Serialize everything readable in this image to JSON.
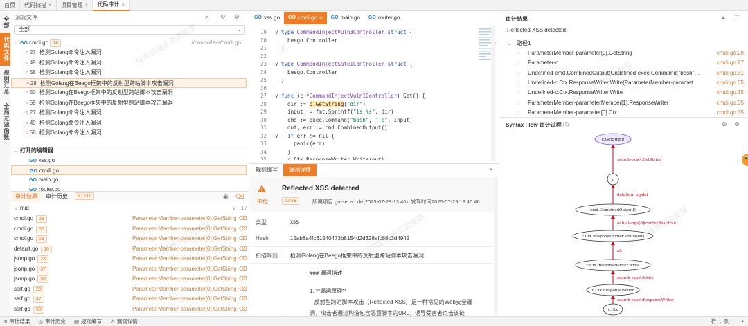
{
  "top_tabs": [
    {
      "label": "首页",
      "active": false,
      "closable": false
    },
    {
      "label": "代码扫描",
      "active": false,
      "closable": true
    },
    {
      "label": "项目管理",
      "active": false,
      "closable": true
    },
    {
      "label": "代码审计",
      "active": true,
      "closable": true
    }
  ],
  "vertical_tabs": [
    "全部",
    "代码文件",
    "规则汇总",
    "全局过滤函数"
  ],
  "file_panel": {
    "title": "漏洞文件",
    "filter_value": "全部",
    "file_name": "cmdi.go",
    "file_count": "18",
    "file_path": "//controllers/cmdi.go",
    "items": [
      {
        "line": "27",
        "text": "检测Golang命令注入漏洞",
        "selected": false
      },
      {
        "line": "49",
        "text": "检测Golang命令注入漏洞",
        "selected": false
      },
      {
        "line": "58",
        "text": "检测Golang命令注入漏洞",
        "selected": false
      },
      {
        "line": "28",
        "text": "检测Golang在Beego框架中的反射型跨站脚本攻击漏洞",
        "selected": true
      },
      {
        "line": "50",
        "text": "检测Golang在Beego框架中的反射型跨站脚本攻击漏洞",
        "selected": false
      },
      {
        "line": "59",
        "text": "检测Golang在Beego框架中的反射型跨站脚本攻击漏洞",
        "selected": false
      },
      {
        "line": "27",
        "text": "检测Golang命令注入漏洞",
        "selected": false
      },
      {
        "line": "49",
        "text": "检测Golang命令注入漏洞",
        "selected": false
      },
      {
        "line": "58",
        "text": "检测Golang命令注入漏洞",
        "selected": false
      }
    ],
    "open_editors_title": "打开的编辑器",
    "open_editors": [
      {
        "name": "xss.go",
        "selected": false
      },
      {
        "name": "cmdi.go",
        "selected": true
      },
      {
        "name": "main.go",
        "selected": false
      },
      {
        "name": "router.go",
        "selected": false
      }
    ]
  },
  "results_panel": {
    "tabs": [
      "审计结果",
      "审计历史"
    ],
    "id_badge": "ID:111",
    "group_name": "mid",
    "group_count": "17",
    "rows": [
      {
        "file": "cmdi.go",
        "count": "28",
        "func": "ParameterMember-parameter[0].GetString"
      },
      {
        "file": "cmdi.go",
        "count": "50",
        "func": "ParameterMember-parameter[0].GetString"
      },
      {
        "file": "cmdi.go",
        "count": "59",
        "func": "ParameterMember-parameter[0].GetString"
      },
      {
        "file": "default.go",
        "count": "16",
        "func": "ParameterMember-parameter[0].GetString"
      },
      {
        "file": "jsonp.go",
        "count": "23",
        "func": "ParameterMember-parameter[0].GetString"
      },
      {
        "file": "jsonp.go",
        "count": "37",
        "func": "ParameterMember-parameter[0].GetString"
      },
      {
        "file": "jsonp.go",
        "count": "58",
        "func": "ParameterMember-parameter[0].GetString"
      },
      {
        "file": "ssrf.go",
        "count": "28",
        "func": "ParameterMember-parameter[0].GetString"
      },
      {
        "file": "ssrf.go",
        "count": "47",
        "func": "ParameterMember-parameter[0].GetString"
      },
      {
        "file": "ssrf.go",
        "count": "68",
        "func": "ParameterMember-parameter[0].GetString"
      },
      {
        "file": "ssrf.go",
        "count": "",
        "func": ""
      }
    ]
  },
  "editor": {
    "tabs": [
      {
        "name": "xss.go",
        "active": false
      },
      {
        "name": "cmdi.go",
        "active": true
      },
      {
        "name": "main.go",
        "active": false
      },
      {
        "name": "router.go",
        "active": false
      }
    ],
    "lines": [
      {
        "no": "19",
        "code": "∨ type CommandInjectVuln3Controller struct {"
      },
      {
        "no": "20",
        "code": "    beego.Controller"
      },
      {
        "no": "21",
        "code": "  }"
      },
      {
        "no": "22",
        "code": ""
      },
      {
        "no": "23",
        "code": "∨ type CommandInjectSafe1Controller struct {"
      },
      {
        "no": "24",
        "code": "    beego.Controller"
      },
      {
        "no": "25",
        "code": "  }"
      },
      {
        "no": "26",
        "code": ""
      },
      {
        "no": "27",
        "code": "∨ func (c *CommandInjectVuln1Controller) Get() {"
      },
      {
        "no": "28",
        "code": "    dir := c.GetString(\"dir\")"
      },
      {
        "no": "29",
        "code": "    input := fmt.Sprintf(\"ls %s\", dir)"
      },
      {
        "no": "30",
        "code": "    cmd := exec.Command(\"bash\", \"-c\", input)"
      },
      {
        "no": "31",
        "code": "    out, err := cmd.CombinedOutput()"
      },
      {
        "no": "32",
        "code": "∨   if err != nil {"
      },
      {
        "no": "33",
        "code": "      panic(err)"
      },
      {
        "no": "34",
        "code": "    }"
      },
      {
        "no": "35",
        "code": "    c.Ctx.ResponseWriter.Write(out)"
      },
      {
        "no": "36",
        "code": "  }"
      }
    ]
  },
  "detail": {
    "tabs": [
      "规则编写",
      "漏洞详情"
    ],
    "title": "Reflected XSS detected",
    "severity": "中危",
    "id": "ID:33",
    "project": "所属项目:go-sec-code(2025-07-29-13:46)",
    "time": "发现时间2025-07-29 13:46:46",
    "fields": [
      {
        "key": "类型",
        "value": "xss"
      },
      {
        "key": "Hash",
        "value": "15ab8a4fc61540473b8154d2d328afc88c3d4942"
      },
      {
        "key": "扫描规则",
        "value": "检测Golang在Beego框架中的反射型跨站脚本攻击漏洞"
      }
    ],
    "desc_heading": "### 漏洞描述",
    "desc_lines": [
      "1. **漏洞原理**",
      "   反射型跨站脚本攻击（Reflected XSS）是一种常见的Web安全漏",
      "洞，攻击者通过构造包含恶意脚本的URL，诱导受害者点击该链"
    ]
  },
  "audit_result": {
    "title": "审计结果",
    "summary": "Reflected XSS detected:",
    "path_label": "路径1",
    "items": [
      {
        "text": "ParameterMember-parameter[0].GetString",
        "loc": "cmdi.go:28"
      },
      {
        "text": "Parameter-c",
        "loc": "cmdi.go:27"
      },
      {
        "text": "Undefined-cmd.CombinedOutput(Undefined-exec.Command(\"bash\",\"-c\",...",
        "loc": "cmdi.go:31"
      },
      {
        "text": "Undefined-c.Ctx.ResponseWriter.Write(ParameterMember-parameterMem...",
        "loc": "cmdi.go:35"
      },
      {
        "text": "Undefined-c.Ctx.ResponseWriter.Write",
        "loc": "cmdi.go:35"
      },
      {
        "text": "ParameterMember-parameterMember[1].ResponseWriter",
        "loc": "cmdi.go:35"
      },
      {
        "text": "ParameterMember-parameter[0].Ctx",
        "loc": "cmdi.go:35"
      }
    ]
  },
  "syntax_flow": {
    "title": "Syntax Flow 审计过程",
    "nodes": [
      "c.GetString",
      "c",
      "cmd.CombinedOutput()",
      "c.Ctx.ResponseWriter.Write(out)",
      "c.Ctx.ResponseWriter.Write",
      "c.Ctx.ResponseWriter",
      "c.Ctx"
    ],
    "edges": [
      "search-exact:GetString",
      "dataflow_topdef",
      "actual-args[0](centerRest:true)",
      "all",
      "search-exact:Write",
      "search-exact:ResponseWriter"
    ]
  },
  "statusbar": {
    "items": [
      "审计结果",
      "审计历史",
      "规则编写",
      "漏洞详情"
    ],
    "position": "行1，列1"
  },
  "watermark": "仅内部技术交流使用",
  "colors": {
    "accent": "#f07c26",
    "link": "#1e7fd8",
    "muted_orange": "#c5803e",
    "edge_red": "#d0021b",
    "top_node": "#7b5cd6"
  }
}
